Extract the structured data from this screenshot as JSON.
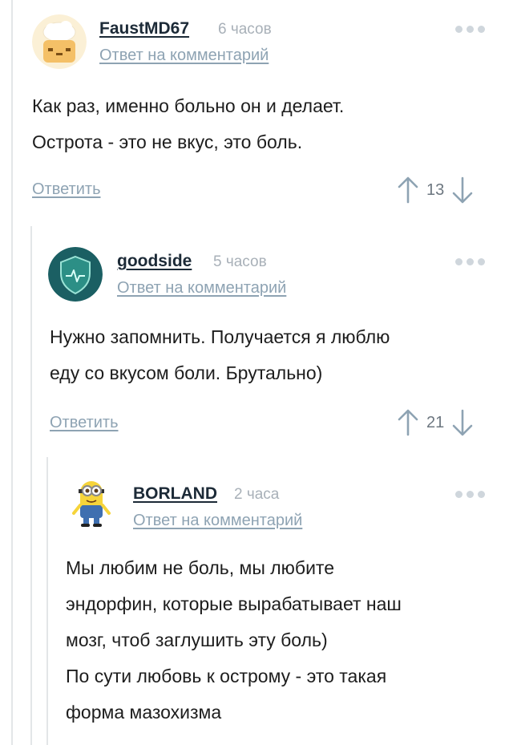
{
  "thread": [
    {
      "author": "FaustMD67",
      "time": "6 часов",
      "reply_to_label": "Ответ на комментарий",
      "text_lines": [
        "Как раз, именно больно он и делает.",
        "Острота - это не вкус, это боль."
      ],
      "answer_label": "Ответить",
      "rating": "13",
      "avatar_icon": "chef-avatar-icon"
    },
    {
      "author": "goodside",
      "time": "5 часов",
      "reply_to_label": "Ответ на комментарий",
      "text_lines": [
        "Нужно запомнить. Получается я люблю",
        "еду со вкусом боли. Брутально)"
      ],
      "answer_label": "Ответить",
      "rating": "21",
      "avatar_icon": "shield-avatar-icon"
    },
    {
      "author": "BORLAND",
      "time": "2 часа",
      "reply_to_label": "Ответ на комментарий",
      "text_lines": [
        "Мы любим не боль, мы любите",
        "эндорфин, которые вырабатывает наш",
        "мозг, чтоб заглушить эту боль)",
        "По сути любовь к острому - это такая",
        "форма мазохизма"
      ],
      "avatar_icon": "minion-avatar-icon"
    }
  ],
  "colors": {
    "author": "#1c2a37",
    "link": "#8ea3b3",
    "muted": "#a8b0b8",
    "thread_line": "#e3e6e8",
    "shield": "#1a6f6a"
  }
}
